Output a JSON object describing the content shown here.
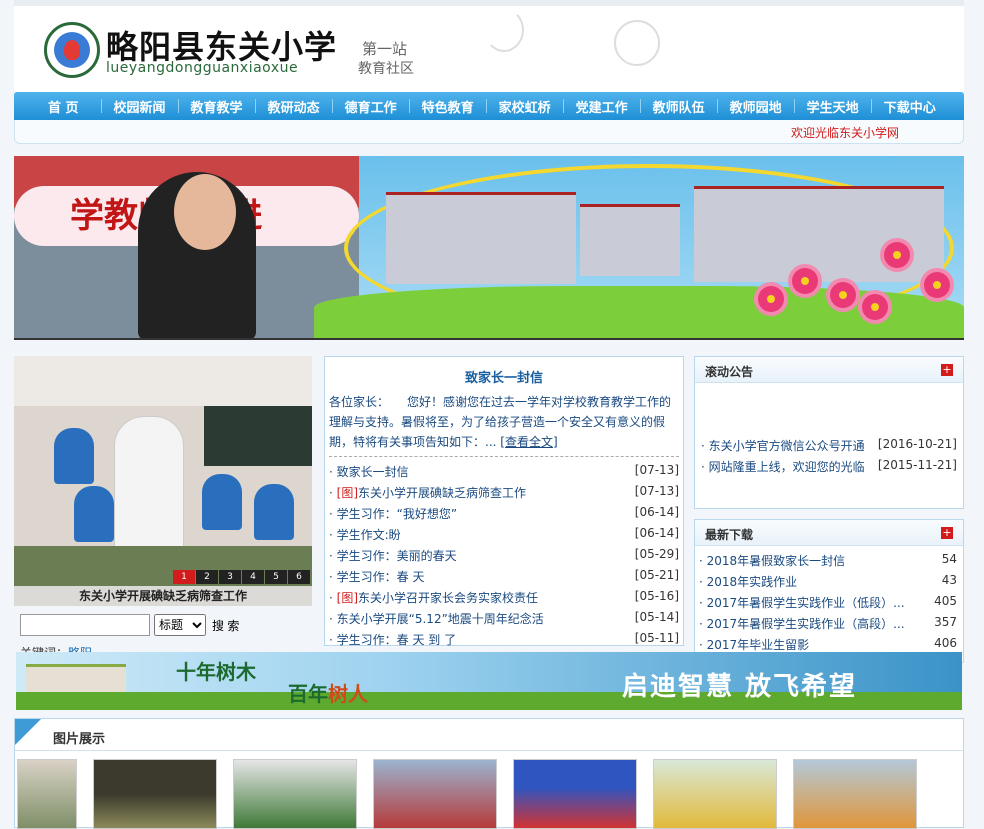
{
  "header": {
    "school_name": "略阳县东关小学",
    "pinyin": "lueyangdongguanxiaoxue",
    "tag1": "第一站",
    "tag2": "教育社区"
  },
  "nav": {
    "items": [
      "首 页",
      "校园新闻",
      "教育教学",
      "教研动态",
      "德育工作",
      "特色教育",
      "家校虹桥",
      "党建工作",
      "教师队伍",
      "教师园地",
      "学生天地",
      "下载中心"
    ]
  },
  "welcome": "欢迎光临东关小学网",
  "banner": {
    "slogan": "学教师“走进"
  },
  "slideshow": {
    "caption": "东关小学开展碘缺乏病筛查工作",
    "pages": [
      "1",
      "2",
      "3",
      "4",
      "5",
      "6"
    ],
    "active_page": "1"
  },
  "search": {
    "select": "标题",
    "button": "搜 索",
    "keywords_label": "关键词：",
    "keyword": "略阳"
  },
  "letter": {
    "title": "致家长一封信",
    "body": "各位家长：　　您好！感谢您在过去一学年对学校教育教学工作的理解与支持。暑假将至，为了给孩子营造一个安全又有意义的假期，特将有关事项告知如下：...",
    "more": "[查看全文]"
  },
  "news": [
    {
      "tag": "",
      "title": "致家长一封信",
      "date": "[07-13]"
    },
    {
      "tag": "[图]",
      "title": "东关小学开展碘缺乏病筛查工作",
      "date": "[07-13]"
    },
    {
      "tag": "",
      "title": "学生习作：“我好想您”",
      "date": "[06-14]"
    },
    {
      "tag": "",
      "title": "学生作文:盼",
      "date": "[06-14]"
    },
    {
      "tag": "",
      "title": "学生习作：美丽的春天",
      "date": "[05-29]"
    },
    {
      "tag": "",
      "title": "学生习作：春 天",
      "date": "[05-21]"
    },
    {
      "tag": "[图]",
      "title": "东关小学召开家长会务实家校责任",
      "date": "[05-16]"
    },
    {
      "tag": "",
      "title": "东关小学开展“5.12”地震十周年纪念活",
      "date": "[05-14]"
    },
    {
      "tag": "",
      "title": "学生习作：春 天 到 了",
      "date": "[05-11]"
    }
  ],
  "notice": {
    "title": "滚动公告",
    "items": [
      {
        "title": "东关小学官方微信公众号开通",
        "date": "[2016-10-21]"
      },
      {
        "title": "网站隆重上线，欢迎您的光临",
        "date": "[2015-11-21]"
      }
    ]
  },
  "downloads": {
    "title": "最新下载",
    "items": [
      {
        "title": "2018年暑假致家长一封信",
        "count": "54"
      },
      {
        "title": "2018年实践作业",
        "count": "43"
      },
      {
        "title": "2017年暑假学生实践作业（低段）...",
        "count": "405"
      },
      {
        "title": "2017年暑假学生实践作业（高段）...",
        "count": "357"
      },
      {
        "title": "2017年毕业生留影",
        "count": "406"
      }
    ]
  },
  "banner2": {
    "slogan1": "十年树木",
    "slogan2a": "百年",
    "slogan2b": "树人",
    "slogan3": "启迪智慧 放飞希望"
  },
  "gallery": {
    "title": "图片展示"
  }
}
